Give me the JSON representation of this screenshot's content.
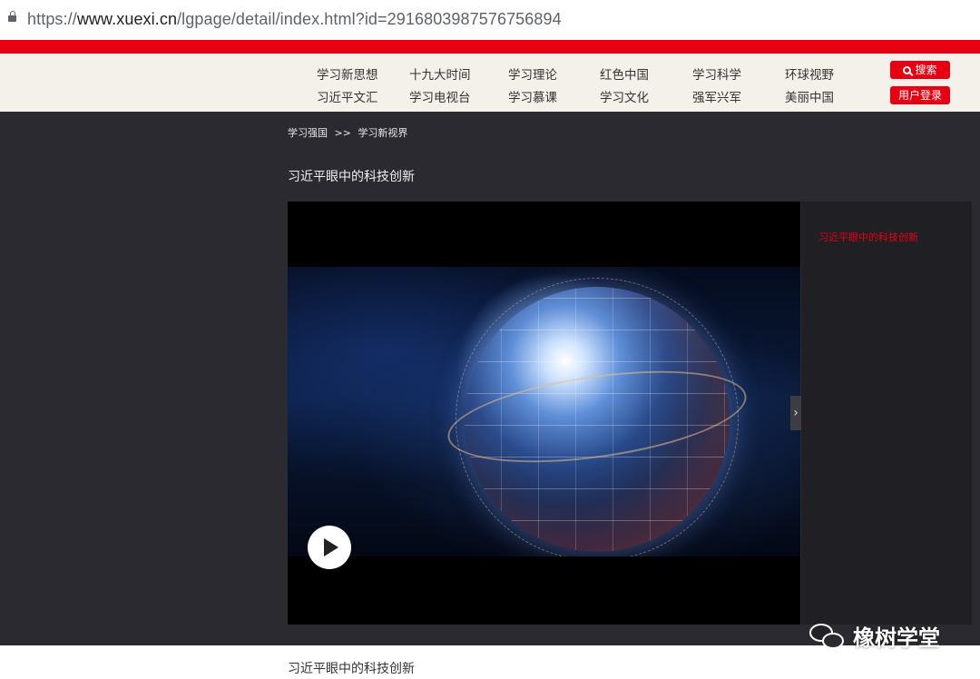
{
  "browser": {
    "url_scheme": "https://",
    "url_host": "www.xuexi.cn",
    "url_path": "/lgpage/detail/index.html?id=2916803987576756894"
  },
  "nav": {
    "row1": [
      "学习新思想",
      "十九大时间",
      "学习理论",
      "红色中国",
      "学习科学",
      "环球视野"
    ],
    "row2": [
      "习近平文汇",
      "学习电视台",
      "学习慕课",
      "学习文化",
      "强军兴军",
      "美丽中国"
    ],
    "search_label": "搜索",
    "login_label": "用户登录"
  },
  "breadcrumb": {
    "home": "学习强国",
    "sep": ">>",
    "current": "学习新视界"
  },
  "page_title": "习近平眼中的科技创新",
  "playlist": {
    "items": [
      "习近平眼中的科技创新"
    ]
  },
  "watermark": {
    "text": "橡树学堂"
  },
  "bottom_title": "习近平眼中的科技创新",
  "colors": {
    "accent": "#e60012",
    "nav_bg": "#f4f0ea",
    "content_bg": "#2b2a30"
  }
}
